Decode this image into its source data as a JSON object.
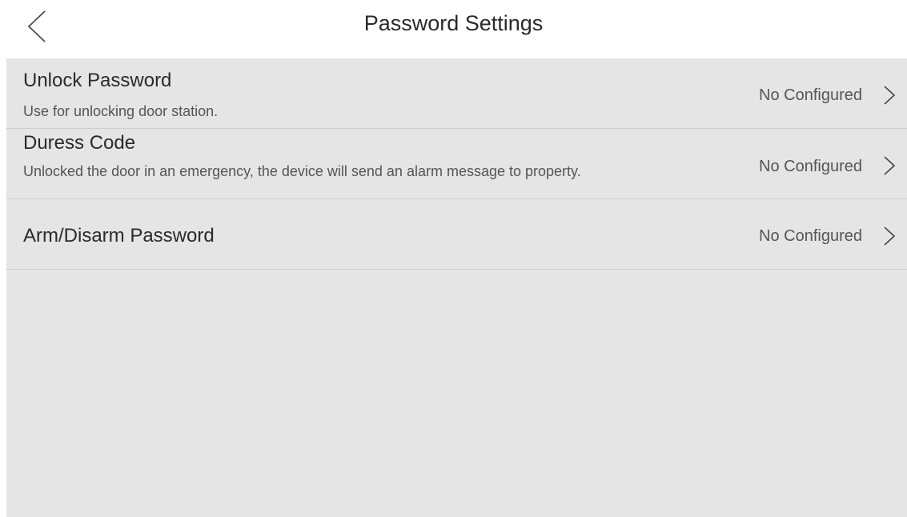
{
  "header": {
    "title": "Password Settings",
    "back_icon": "chevron-left-icon"
  },
  "rows": [
    {
      "title": "Unlock Password",
      "description": "Use for unlocking door station.",
      "status": "No Configured",
      "icon": "chevron-right-icon"
    },
    {
      "title": "Duress Code",
      "description": "Unlocked the door in an emergency, the device will send an alarm message to property.",
      "status": "No Configured",
      "icon": "chevron-right-icon"
    },
    {
      "title": "Arm/Disarm Password",
      "status": "No Configured",
      "icon": "chevron-right-icon"
    }
  ],
  "colors": {
    "panel_background": "#e5e5e5",
    "divider": "#cdcdcd",
    "text_primary": "#2a2a2a",
    "text_secondary": "#555555"
  }
}
